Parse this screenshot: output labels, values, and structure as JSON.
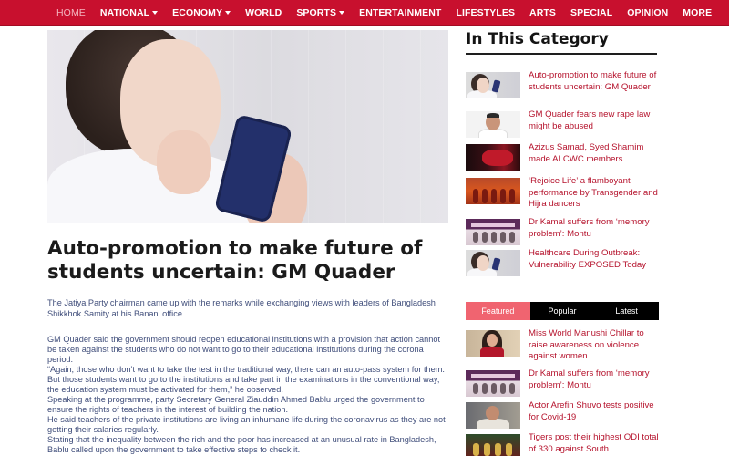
{
  "nav": {
    "items": [
      {
        "label": "HOME",
        "active": true,
        "dropdown": false
      },
      {
        "label": "NATIONAL",
        "active": false,
        "dropdown": true
      },
      {
        "label": "ECONOMY",
        "active": false,
        "dropdown": true
      },
      {
        "label": "WORLD",
        "active": false,
        "dropdown": false
      },
      {
        "label": "SPORTS",
        "active": false,
        "dropdown": true
      },
      {
        "label": "ENTERTAINMENT",
        "active": false,
        "dropdown": false
      },
      {
        "label": "LIFESTYLES",
        "active": false,
        "dropdown": false
      },
      {
        "label": "ARTS",
        "active": false,
        "dropdown": false
      },
      {
        "label": "SPECIAL",
        "active": false,
        "dropdown": false
      },
      {
        "label": "OPINION",
        "active": false,
        "dropdown": false
      },
      {
        "label": "MORE",
        "active": false,
        "dropdown": false
      }
    ],
    "background_color": "#c8102e"
  },
  "article": {
    "title": "Auto-promotion to make future of students uncertain: GM Quader",
    "lead": "The Jatiya Party chairman came up with the remarks while exchanging views with leaders of Bangladesh Shikkhok Samity at his Banani office.",
    "paragraphs": [
      "GM Quader said the government should reopen educational institutions with a provision that action cannot be taken against the students who do not want to go to their educational institutions during the corona period.",
      "“Again, those who don’t want to take the test in the traditional way, there can an auto-pass system for them. But those students want to go to the institutions and take part in the examinations in the conventional way, the education system must be activated for them,” he observed.",
      "Speaking at the programme, party Secretary General Ziauddin Ahmed Bablu urged the government to ensure the rights of teachers in the interest of building the nation.",
      "He said teachers of the private institutions are living an inhumane life during the coronavirus as they are not getting their salaries regularly.",
      "Stating that the inequality between the rich and the poor has increased at an unusual rate in Bangladesh, Bablu called upon the government to take effective steps to check it."
    ]
  },
  "sidebar": {
    "heading": "In This Category",
    "category_items": [
      {
        "title": "Auto-promotion to make future of students uncertain: GM Quader",
        "thumb": "girl-phone-thumbnail"
      },
      {
        "title": "GM Quader fears new rape law might be abused",
        "thumb": "man-portrait-thumbnail"
      },
      {
        "title": "Azizus Samad, Syed Shamim made ALCWC members",
        "thumb": "red-event-thumbnail"
      },
      {
        "title": "‘Rejoice Life’ a flamboyant performance by Transgender and Hijra dancers",
        "thumb": "stage-dancers-thumbnail"
      },
      {
        "title": "Dr Kamal suffers from ‘memory problem’: Montu",
        "thumb": "press-event-thumbnail"
      },
      {
        "title": "Healthcare During Outbreak: Vulnerability EXPOSED Today",
        "thumb": "girl-phone-thumbnail"
      }
    ],
    "tabs": [
      {
        "label": "Featured",
        "active": true
      },
      {
        "label": "Popular",
        "active": false
      },
      {
        "label": "Latest",
        "active": false
      }
    ],
    "featured_items": [
      {
        "title": "Miss World Manushi Chillar to raise awareness on violence against women",
        "thumb": "miss-world-thumbnail"
      },
      {
        "title": "Dr Kamal suffers from ‘memory problem’: Montu",
        "thumb": "press-event-thumbnail"
      },
      {
        "title": "Actor Arefin Shuvo tests positive for Covid-19",
        "thumb": "actor-thumbnail"
      },
      {
        "title": "Tigers post their highest ODI total of 330 against South",
        "thumb": "cricket-crowd-thumbnail"
      }
    ],
    "link_color": "#b5122c",
    "active_tab_color": "#f06470"
  }
}
